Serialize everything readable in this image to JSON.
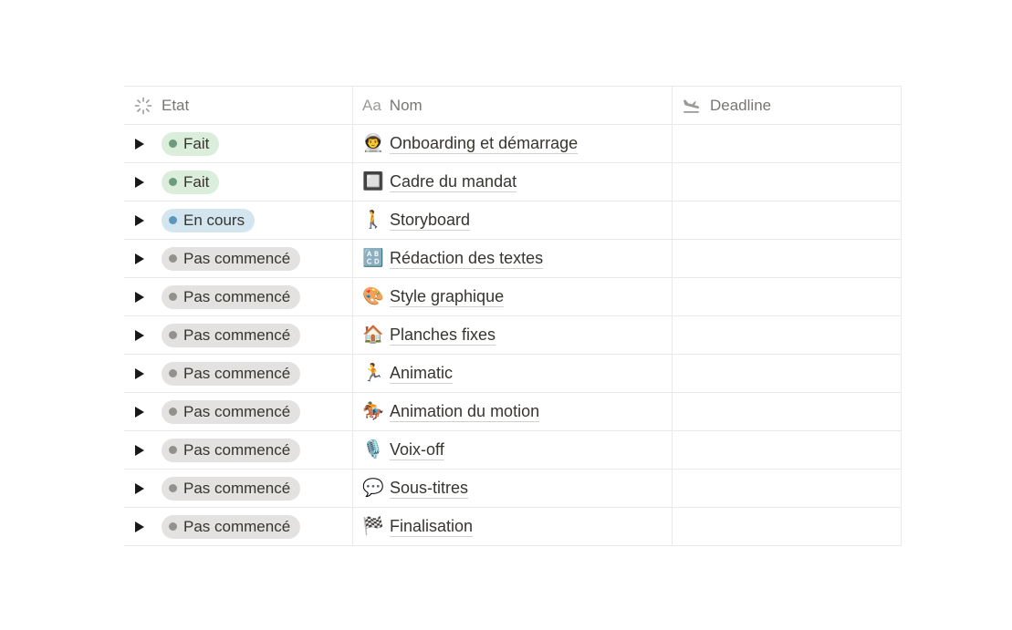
{
  "columns": {
    "etat": "Etat",
    "nom_icon_text": "Aa",
    "nom": "Nom",
    "deadline": "Deadline"
  },
  "status_colors": {
    "done": {
      "bg": "#dbeddb",
      "dot": "#6c9b7d"
    },
    "in_progress": {
      "bg": "#d3e5ef",
      "dot": "#5b97bd"
    },
    "not_started": {
      "bg": "#e3e2e0",
      "dot": "#91918e"
    }
  },
  "rows": [
    {
      "status": "Fait",
      "status_kind": "done",
      "emoji": "👨‍🚀",
      "title": "Onboarding et démarrage",
      "deadline": ""
    },
    {
      "status": "Fait",
      "status_kind": "done",
      "emoji": "🔲",
      "title": "Cadre du mandat",
      "deadline": ""
    },
    {
      "status": "En cours",
      "status_kind": "in_progress",
      "emoji": "🚶",
      "title": "Storyboard",
      "deadline": ""
    },
    {
      "status": "Pas commencé",
      "status_kind": "not_started",
      "emoji": "🔠",
      "title": "Rédaction des textes",
      "deadline": ""
    },
    {
      "status": "Pas commencé",
      "status_kind": "not_started",
      "emoji": "🎨",
      "title": "Style graphique",
      "deadline": ""
    },
    {
      "status": "Pas commencé",
      "status_kind": "not_started",
      "emoji": "🏠",
      "title": "Planches fixes",
      "deadline": ""
    },
    {
      "status": "Pas commencé",
      "status_kind": "not_started",
      "emoji": "🏃",
      "title": "Animatic",
      "deadline": ""
    },
    {
      "status": "Pas commencé",
      "status_kind": "not_started",
      "emoji": "🏇",
      "title": "Animation du motion",
      "deadline": ""
    },
    {
      "status": "Pas commencé",
      "status_kind": "not_started",
      "emoji": "🎙️",
      "title": "Voix-off",
      "deadline": ""
    },
    {
      "status": "Pas commencé",
      "status_kind": "not_started",
      "emoji": "💬",
      "title": "Sous-titres",
      "deadline": ""
    },
    {
      "status": "Pas commencé",
      "status_kind": "not_started",
      "emoji": "🏁",
      "title": "Finalisation",
      "deadline": ""
    }
  ],
  "icons": {
    "etat": "loading-spinner-icon",
    "nom": "text-aa-icon",
    "deadline": "plane-landing-icon",
    "toggle": "triangle-right-icon"
  }
}
